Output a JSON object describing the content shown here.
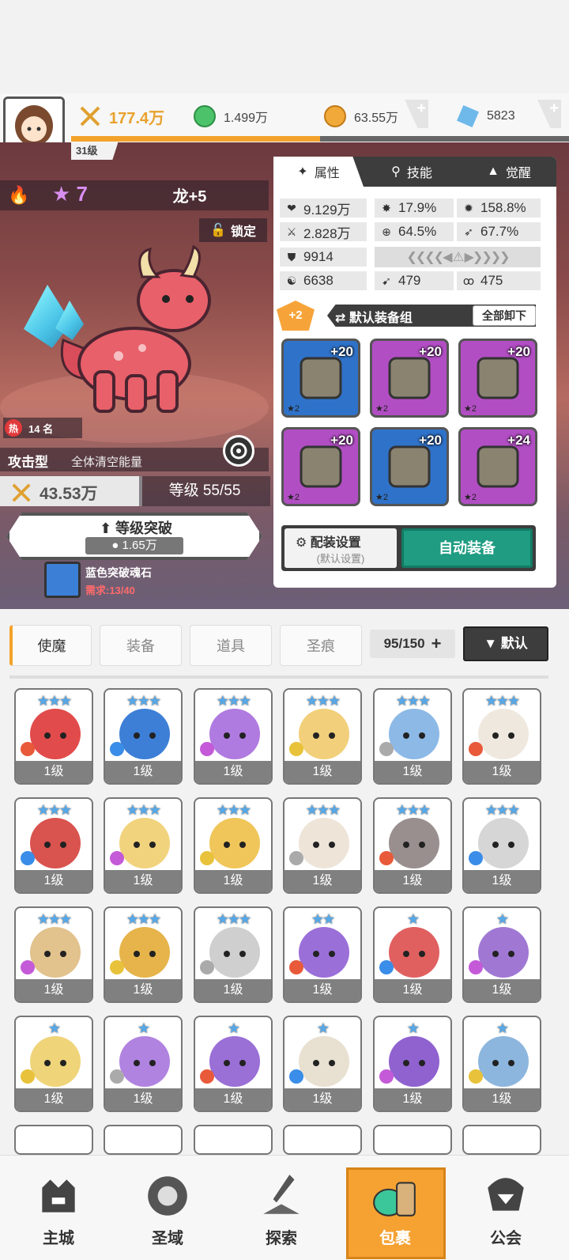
{
  "header": {
    "power": "177.4万",
    "resources": [
      {
        "name": "green-gem",
        "value": "1.499万",
        "color": "#4cc36a"
      },
      {
        "name": "gold-coin",
        "value": "63.55万",
        "color": "#f1a93a"
      },
      {
        "name": "diamond",
        "value": "5823",
        "color": "#6fb9ea"
      }
    ],
    "level": "31级"
  },
  "hero": {
    "stars": "7",
    "name": "龙+5",
    "lock_label": "锁定",
    "hot_tag": "热",
    "rank": "14 名",
    "type": "攻击型",
    "skill_desc": "全体清空能量",
    "power": "43.53万",
    "level_label": "等级 55/55",
    "breakthrough_label": "等级突破",
    "breakthrough_cost": "1.65万",
    "material_name": "蓝色突破魂石",
    "material_req": "需求:13/40"
  },
  "panel": {
    "tabs": [
      "属性",
      "技能",
      "觉醒"
    ],
    "stats": [
      {
        "icon": "heart-icon",
        "glyph": "❤",
        "value": "9.129万"
      },
      {
        "icon": "burst-icon",
        "glyph": "✸",
        "value": "17.9%"
      },
      {
        "icon": "sun-icon",
        "glyph": "✹",
        "value": "158.8%"
      },
      {
        "icon": "sword-icon",
        "glyph": "⚔",
        "value": "2.828万"
      },
      {
        "icon": "crosshair-icon",
        "glyph": "⊕",
        "value": "64.5%"
      },
      {
        "icon": "wing-icon",
        "glyph": "➶",
        "value": "67.7%"
      },
      {
        "icon": "shield-icon",
        "glyph": "⛊",
        "value": "9914"
      },
      {
        "icon": "swirl-icon",
        "glyph": "☯",
        "value": "6638"
      },
      {
        "icon": "scythe-icon",
        "glyph": "➹",
        "value": "479"
      },
      {
        "icon": "spiral-icon",
        "glyph": "ꝏ",
        "value": "475"
      }
    ],
    "equip_badge": "+2",
    "equip_set_label": "默认装备组",
    "unequip_all": "全部卸下",
    "slots": [
      {
        "name": "sword",
        "level": "+20",
        "stars": "★2",
        "bg": "#2f72c9"
      },
      {
        "name": "helmet",
        "level": "+20",
        "stars": "★2",
        "bg": "#b24ec4"
      },
      {
        "name": "armor",
        "level": "+20",
        "stars": "★2",
        "bg": "#b24ec4"
      },
      {
        "name": "belt",
        "level": "+20",
        "stars": "★2",
        "bg": "#b24ec4"
      },
      {
        "name": "necklace",
        "level": "+20",
        "stars": "★2",
        "bg": "#2f72c9"
      },
      {
        "name": "boots",
        "level": "+24",
        "stars": "★2",
        "bg": "#b24ec4"
      }
    ],
    "config_label": "配装设置",
    "config_sub": "(默认设置)",
    "auto_equip": "自动装备"
  },
  "inventory": {
    "tabs": [
      "使魔",
      "装备",
      "道具",
      "圣痕"
    ],
    "count": "95/150",
    "sort_label": "▼ 默认",
    "heroes": [
      {
        "stars": "★★★",
        "level": "1级",
        "color": "#e24b4b"
      },
      {
        "stars": "★★★",
        "level": "1级",
        "color": "#3d7fd6"
      },
      {
        "stars": "★★★",
        "level": "1级",
        "color": "#b07be0"
      },
      {
        "stars": "★★★",
        "level": "1级",
        "color": "#f2cf7a"
      },
      {
        "stars": "★★★",
        "level": "1级",
        "color": "#8cb9e6"
      },
      {
        "stars": "★★★",
        "level": "1级",
        "color": "#efe8de"
      },
      {
        "stars": "★★★",
        "level": "1级",
        "color": "#d9534f"
      },
      {
        "stars": "★★★",
        "level": "1级",
        "color": "#f2d37d"
      },
      {
        "stars": "★★★",
        "level": "1级",
        "color": "#f0c65a"
      },
      {
        "stars": "★★★",
        "level": "1级",
        "color": "#eee4d8"
      },
      {
        "stars": "★★★",
        "level": "1级",
        "color": "#9a8f8f"
      },
      {
        "stars": "★★★",
        "level": "1级",
        "color": "#d6d6d6"
      },
      {
        "stars": "★★★",
        "level": "1级",
        "color": "#e2c28d"
      },
      {
        "stars": "★★★",
        "level": "1级",
        "color": "#e6b44a"
      },
      {
        "stars": "★★★",
        "level": "1级",
        "color": "#cfcfcf"
      },
      {
        "stars": "★★",
        "level": "1级",
        "color": "#9b6fd8"
      },
      {
        "stars": "★",
        "level": "1级",
        "color": "#e06060"
      },
      {
        "stars": "★",
        "level": "1级",
        "color": "#a078d4"
      },
      {
        "stars": "★",
        "level": "1级",
        "color": "#f0d47a"
      },
      {
        "stars": "★",
        "level": "1级",
        "color": "#b083e0"
      },
      {
        "stars": "★",
        "level": "1级",
        "color": "#9a6fd6"
      },
      {
        "stars": "★",
        "level": "1级",
        "color": "#e8e0d0"
      },
      {
        "stars": "★",
        "level": "1级",
        "color": "#8f62cf"
      },
      {
        "stars": "★",
        "level": "1级",
        "color": "#8cb6de"
      }
    ]
  },
  "nav": [
    "主城",
    "圣域",
    "探索",
    "包裹",
    "公会"
  ]
}
